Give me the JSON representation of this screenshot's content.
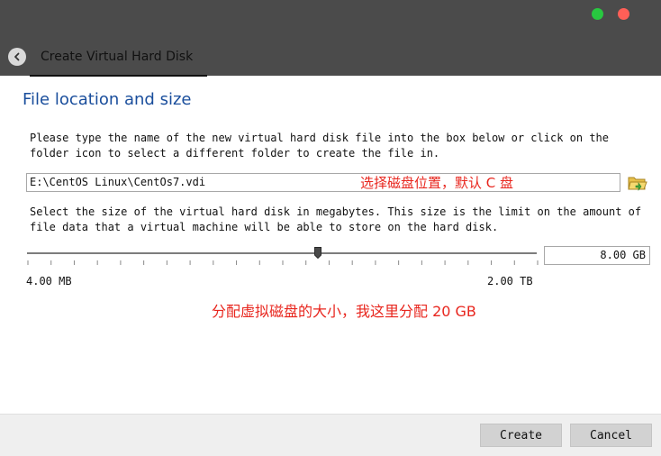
{
  "window": {
    "title": "Create Virtual Hard Disk",
    "controls": {
      "minimize_color": "#28c840",
      "close_color": "#ff5f57"
    }
  },
  "section": {
    "heading": "File location and size"
  },
  "location": {
    "description": "Please type the name of the new virtual hard disk file into the box below or click on the folder icon to select a different folder to create the file in.",
    "path_value": "E:\\CentOS Linux\\CentOs7.vdi",
    "annotation": "选择磁盘位置，默认 C 盘"
  },
  "size": {
    "description": "Select the size of the virtual hard disk in megabytes. This size is the limit on the amount of file data that a virtual machine will be able to store on the hard disk.",
    "value": "8.00 GB",
    "min_label": "4.00 MB",
    "max_label": "2.00 TB",
    "slider_fraction": 0.57,
    "annotation": "分配虚拟磁盘的大小，我这里分配 20 GB"
  },
  "buttons": {
    "create": "Create",
    "cancel": "Cancel"
  },
  "colors": {
    "heading": "#1a4e9c",
    "annotation": "#e8261e",
    "titlebar": "#4b4b4b"
  },
  "icons": {
    "back": "chevron-left-icon",
    "folder": "folder-open-icon"
  }
}
